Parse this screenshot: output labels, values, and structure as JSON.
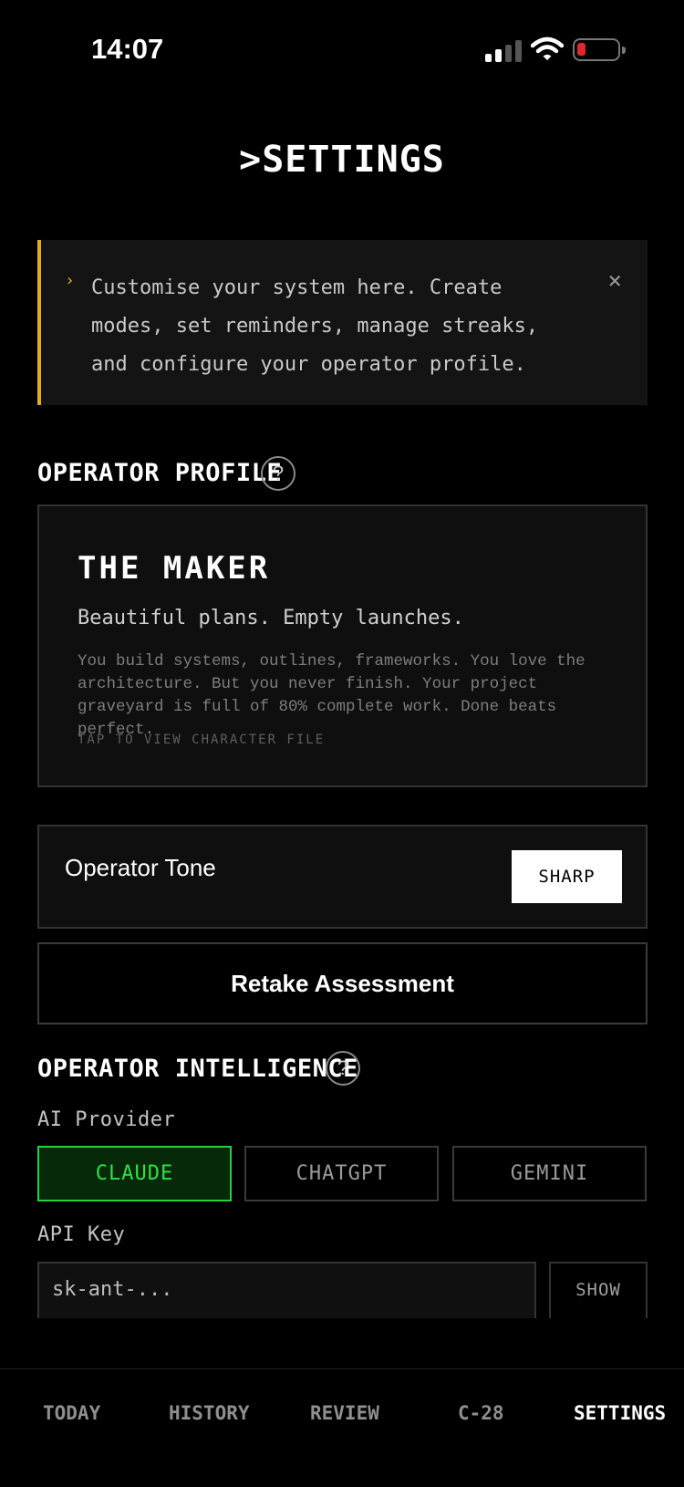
{
  "status": {
    "time": "14:07"
  },
  "title": ">SETTINGS",
  "tip": {
    "chevron": "›",
    "text": "Customise your system here. Create modes, set reminders, manage streaks, and configure your operator profile.",
    "close": "×"
  },
  "profile": {
    "section_title": "OPERATOR PROFILE",
    "help": "?",
    "name": "THE MAKER",
    "tagline": "Beautiful plans. Empty launches.",
    "description": "You build systems, outlines, frameworks. You love the architecture. But you never finish. Your project graveyard is full of 80% complete work. Done beats perfect.",
    "cta": "TAP TO VIEW CHARACTER FILE"
  },
  "tone": {
    "label": "Operator Tone",
    "value": "SHARP"
  },
  "retake": "Retake Assessment",
  "intelligence": {
    "section_title": "OPERATOR INTELLIGENCE",
    "help": "?",
    "provider_label": "AI Provider",
    "providers": [
      "CLAUDE",
      "CHATGPT",
      "GEMINI"
    ],
    "active_provider": "CLAUDE",
    "api_label": "API Key",
    "api_value": "sk-ant-...",
    "show": "SHOW"
  },
  "nav": [
    "TODAY",
    "HISTORY",
    "REVIEW",
    "C-28",
    "SETTINGS"
  ],
  "active_nav": "SETTINGS",
  "colors": {
    "accent_amber": "#e5a823",
    "active_green": "#2ee046",
    "battery_red": "#e3262b"
  }
}
